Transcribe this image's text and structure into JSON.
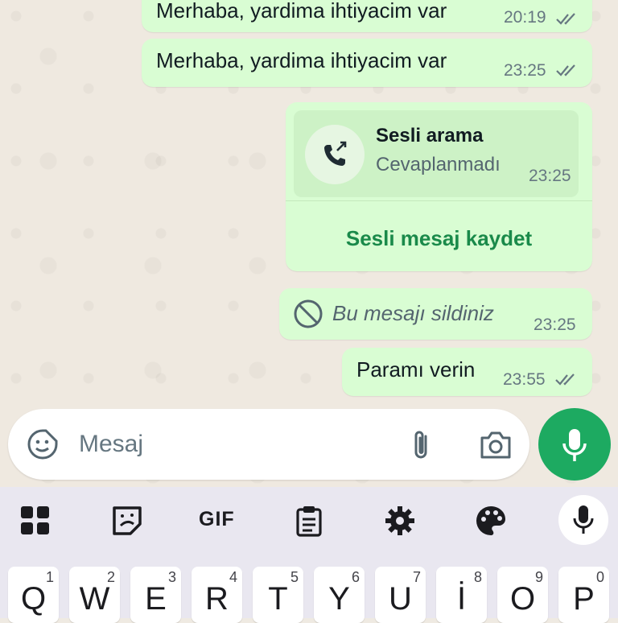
{
  "messages": [
    {
      "text": "Merhaba, yardima ihtiyacim var",
      "time": "20:19",
      "status": "read"
    },
    {
      "text": "Merhaba, yardima ihtiyacim var",
      "time": "23:25",
      "status": "read"
    }
  ],
  "call": {
    "title": "Sesli arama",
    "subtitle": "Cevaplanmadı",
    "time": "23:25",
    "action_label": "Sesli mesaj kaydet",
    "icon": "missed-outgoing-call-icon"
  },
  "deleted": {
    "text": "Bu mesajı sildiniz",
    "time": "23:25",
    "icon": "block-icon"
  },
  "last": {
    "text": "Paramı verin",
    "time": "23:55",
    "status": "read"
  },
  "composer": {
    "placeholder": "Mesaj",
    "icons": [
      "sticker-icon",
      "paperclip-icon",
      "camera-icon",
      "microphone-icon"
    ]
  },
  "keyboard": {
    "toolbar": [
      "apps-grid-icon",
      "sticker-icon",
      "GIF",
      "clipboard-icon",
      "settings-icon",
      "palette-icon",
      "microphone-icon"
    ],
    "gif_label": "GIF",
    "keys": [
      {
        "letter": "Q",
        "num": "1"
      },
      {
        "letter": "W",
        "num": "2"
      },
      {
        "letter": "E",
        "num": "3"
      },
      {
        "letter": "R",
        "num": "4"
      },
      {
        "letter": "T",
        "num": "5"
      },
      {
        "letter": "Y",
        "num": "6"
      },
      {
        "letter": "U",
        "num": "7"
      },
      {
        "letter": "İ",
        "num": "8"
      },
      {
        "letter": "O",
        "num": "9"
      },
      {
        "letter": "P",
        "num": "0"
      }
    ]
  },
  "colors": {
    "bubble": "#d9fdd3",
    "accent": "#1daa61",
    "link": "#1a8a4a",
    "tick": "#667781"
  }
}
